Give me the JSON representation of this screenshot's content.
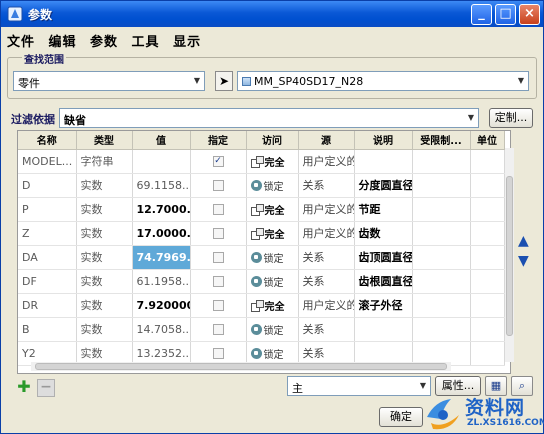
{
  "window": {
    "title": "参数"
  },
  "titlebar_buttons": [
    "_",
    "□",
    "×"
  ],
  "menu": [
    "文件",
    "编辑",
    "参数",
    "工具",
    "显示"
  ],
  "lookup": {
    "group_label": "查找范围",
    "scope_value": "零件",
    "model_value": "MM_SP40SD17_N28"
  },
  "filter": {
    "label": "过滤依据",
    "value": "缺省",
    "customize_button": "定制..."
  },
  "table": {
    "columns": [
      "名称",
      "类型",
      "值",
      "指定",
      "访问",
      "源",
      "说明",
      "受限制...",
      "单位"
    ],
    "rows": [
      {
        "name": "MODEL...",
        "type": "字符串",
        "value": "",
        "designated": true,
        "access": "完全",
        "locked": false,
        "source": "用户定义的",
        "desc": ""
      },
      {
        "name": "D",
        "type": "实数",
        "value": "69.1158...",
        "designated": false,
        "access": "锁定",
        "locked": true,
        "source": "关系",
        "desc": "分度圆直径"
      },
      {
        "name": "P",
        "type": "实数",
        "value": "12.7000...",
        "designated": false,
        "access": "完全",
        "locked": false,
        "source": "用户定义的",
        "desc": "节距"
      },
      {
        "name": "Z",
        "type": "实数",
        "value": "17.0000...",
        "designated": false,
        "access": "完全",
        "locked": false,
        "source": "用户定义的",
        "desc": "齿数"
      },
      {
        "name": "DA",
        "type": "实数",
        "value": "74.7969...",
        "designated": false,
        "access": "锁定",
        "locked": true,
        "source": "关系",
        "desc": "齿顶圆直径"
      },
      {
        "name": "DF",
        "type": "实数",
        "value": "61.1958...",
        "designated": false,
        "access": "锁定",
        "locked": true,
        "source": "关系",
        "desc": "齿根圆直径"
      },
      {
        "name": "DR",
        "type": "实数",
        "value": "7.920000",
        "designated": false,
        "access": "完全",
        "locked": false,
        "source": "用户定义的",
        "desc": "滚子外径"
      },
      {
        "name": "B",
        "type": "实数",
        "value": "14.7058...",
        "designated": false,
        "access": "锁定",
        "locked": true,
        "source": "关系",
        "desc": ""
      },
      {
        "name": "Y2",
        "type": "实数",
        "value": "13.2352...",
        "designated": false,
        "access": "锁定",
        "locked": true,
        "source": "关系",
        "desc": ""
      }
    ]
  },
  "bottom": {
    "main_value": "主",
    "properties_button": "属性...",
    "ok_button": "确定"
  },
  "watermark": {
    "main": "资料网",
    "sub": "ZL.XS1616.COM"
  },
  "colors": {
    "title_blue": "#0a58d6",
    "highlight": "#5fa9d8",
    "add_green": "#2a9a2a"
  }
}
